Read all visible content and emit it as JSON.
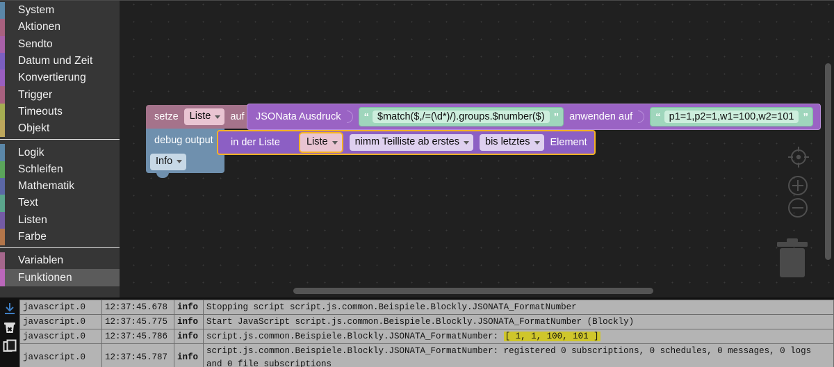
{
  "toolbox": {
    "groups": [
      {
        "items": [
          {
            "label": "System",
            "color": "#5b87a8",
            "name": "system"
          },
          {
            "label": "Aktionen",
            "color": "#a8617f",
            "name": "aktionen"
          },
          {
            "label": "Sendto",
            "color": "#a860a8",
            "name": "sendto"
          },
          {
            "label": "Datum und Zeit",
            "color": "#7b5fc0",
            "name": "datum-und-zeit"
          },
          {
            "label": "Konvertierung",
            "color": "#9a5fc0",
            "name": "konvertierung"
          },
          {
            "label": "Trigger",
            "color": "#a8617f",
            "name": "trigger"
          },
          {
            "label": "Timeouts",
            "color": "#a5ad52",
            "name": "timeouts"
          },
          {
            "label": "Objekt",
            "color": "#bda75c",
            "name": "objekt"
          }
        ]
      },
      {
        "items": [
          {
            "label": "Logik",
            "color": "#5b87a8",
            "name": "logik"
          },
          {
            "label": "Schleifen",
            "color": "#5ba55b",
            "name": "schleifen"
          },
          {
            "label": "Mathematik",
            "color": "#5b67a5",
            "name": "mathematik"
          },
          {
            "label": "Text",
            "color": "#5ba58c",
            "name": "text"
          },
          {
            "label": "Listen",
            "color": "#745ba5",
            "name": "listen"
          },
          {
            "label": "Farbe",
            "color": "#b3764a",
            "name": "farbe"
          }
        ]
      },
      {
        "items": [
          {
            "label": "Variablen",
            "color": "#a5678c",
            "name": "variablen"
          },
          {
            "label": "Funktionen",
            "color": "#bb67bb",
            "name": "funktionen",
            "selected": true
          }
        ]
      }
    ]
  },
  "workspace": {
    "blocks": {
      "set_variable": {
        "prefix": "setze",
        "variable": "Liste",
        "suffix": "auf"
      },
      "jsonata": {
        "label": "JSONata Ausdruck",
        "expression": "$match($,/=(\\d*)/).groups.$number($)",
        "apply_label": "anwenden auf",
        "apply_value": "p1=1,p2=1,w1=100,w2=101",
        "quote_open": "“",
        "quote_close": "”"
      },
      "debug_output": {
        "label": "debug output",
        "severity": "Info"
      },
      "sublist": {
        "in_list_label": "in der Liste",
        "variable": "Liste",
        "from_label": "nimm Teilliste ab erstes",
        "to_label": "bis letztes",
        "element_label": "Element"
      }
    },
    "controls": {
      "center": "center-target-icon",
      "zoom_in": "zoom-in-icon",
      "zoom_out": "zoom-out-icon",
      "trash": "trash-icon"
    }
  },
  "log_panel": {
    "tools": [
      {
        "name": "download-logs-icon",
        "glyph": "download"
      },
      {
        "name": "clear-logs-icon",
        "glyph": "trash-x"
      },
      {
        "name": "copy-logs-icon",
        "glyph": "copy"
      }
    ],
    "rows": [
      {
        "source": "javascript.0",
        "time": "12:37:45.678",
        "severity": "info",
        "message": "Stopping script script.js.common.Beispiele.Blockly.JSONATA_FormatNumber",
        "highlight": ""
      },
      {
        "source": "javascript.0",
        "time": "12:37:45.775",
        "severity": "info",
        "message": "Start JavaScript script.js.common.Beispiele.Blockly.JSONATA_FormatNumber (Blockly)",
        "highlight": ""
      },
      {
        "source": "javascript.0",
        "time": "12:37:45.786",
        "severity": "info",
        "message": "script.js.common.Beispiele.Blockly.JSONATA_FormatNumber: ",
        "highlight": "[ 1, 1, 100, 101 ]"
      },
      {
        "source": "javascript.0",
        "time": "12:37:45.787",
        "severity": "info",
        "message": "script.js.common.Beispiele.Blockly.JSONATA_FormatNumber: registered 0 subscriptions, 0 schedules, 0 messages, 0 logs and 0 file subscriptions",
        "highlight": ""
      }
    ]
  },
  "colors": {
    "block_variable": "#a5738b",
    "block_debug": "#6f90ae",
    "block_jsonata": "#9a63c4",
    "block_sublist": "#8c5fc4",
    "block_string": "#9fd6bc",
    "highlight_border": "#f5b324",
    "log_highlight": "#cfc62b",
    "workspace_bg": "#202020",
    "toolbox_bg": "#363636"
  }
}
